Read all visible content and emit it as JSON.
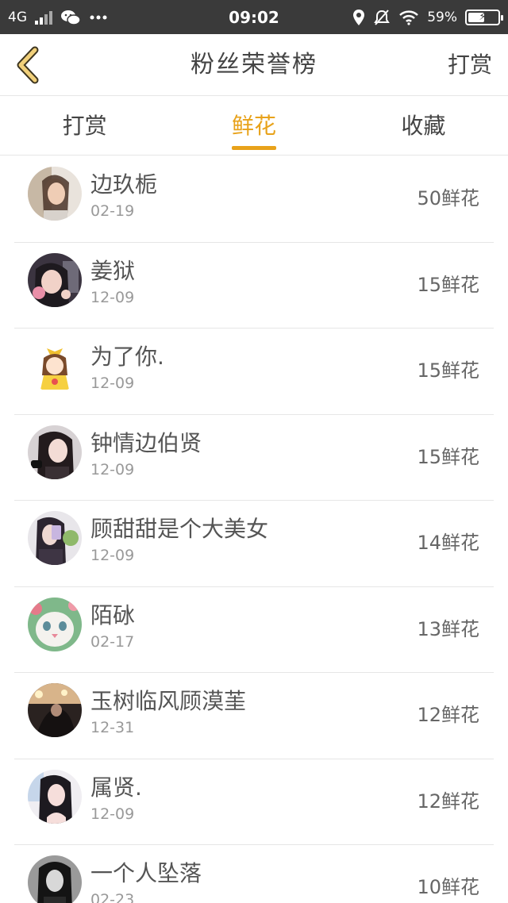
{
  "status_bar": {
    "network": "4G",
    "time": "09:02",
    "battery": "59%",
    "icons": [
      "signal-icon",
      "wechat-icon",
      "more-dots-icon",
      "location-icon",
      "mute-bell-icon",
      "wifi-icon",
      "battery-icon"
    ]
  },
  "header": {
    "title": "粉丝荣誉榜",
    "action_label": "打赏",
    "back_icon": "chevron-left-icon",
    "accent_color": "#e8a21a"
  },
  "tabs": [
    {
      "label": "打赏",
      "active": false
    },
    {
      "label": "鲜花",
      "active": true
    },
    {
      "label": "收藏",
      "active": false
    }
  ],
  "fans": [
    {
      "name": "边玖栀",
      "date": "02-19",
      "count": "50鲜花",
      "avatar": "avatar-photo-girl-1"
    },
    {
      "name": "姜狱",
      "date": "12-09",
      "count": "15鲜花",
      "avatar": "avatar-photo-girl-2"
    },
    {
      "name": "为了你.",
      "date": "12-09",
      "count": "15鲜花",
      "avatar": "avatar-cartoon-girl"
    },
    {
      "name": "钟情边伯贤",
      "date": "12-09",
      "count": "15鲜花",
      "avatar": "avatar-photo-girl-3"
    },
    {
      "name": "顾甜甜是个大美女",
      "date": "12-09",
      "count": "14鲜花",
      "avatar": "avatar-photo-girl-4"
    },
    {
      "name": "陌砅",
      "date": "02-17",
      "count": "13鲜花",
      "avatar": "avatar-cat"
    },
    {
      "name": "玉树临风顾漠茥",
      "date": "12-31",
      "count": "12鲜花",
      "avatar": "avatar-photo-dark"
    },
    {
      "name": "属贤.",
      "date": "12-09",
      "count": "12鲜花",
      "avatar": "avatar-photo-girl-5"
    },
    {
      "name": "一个人坠落",
      "date": "02-23",
      "count": "10鲜花",
      "avatar": "avatar-photo-bw"
    }
  ]
}
